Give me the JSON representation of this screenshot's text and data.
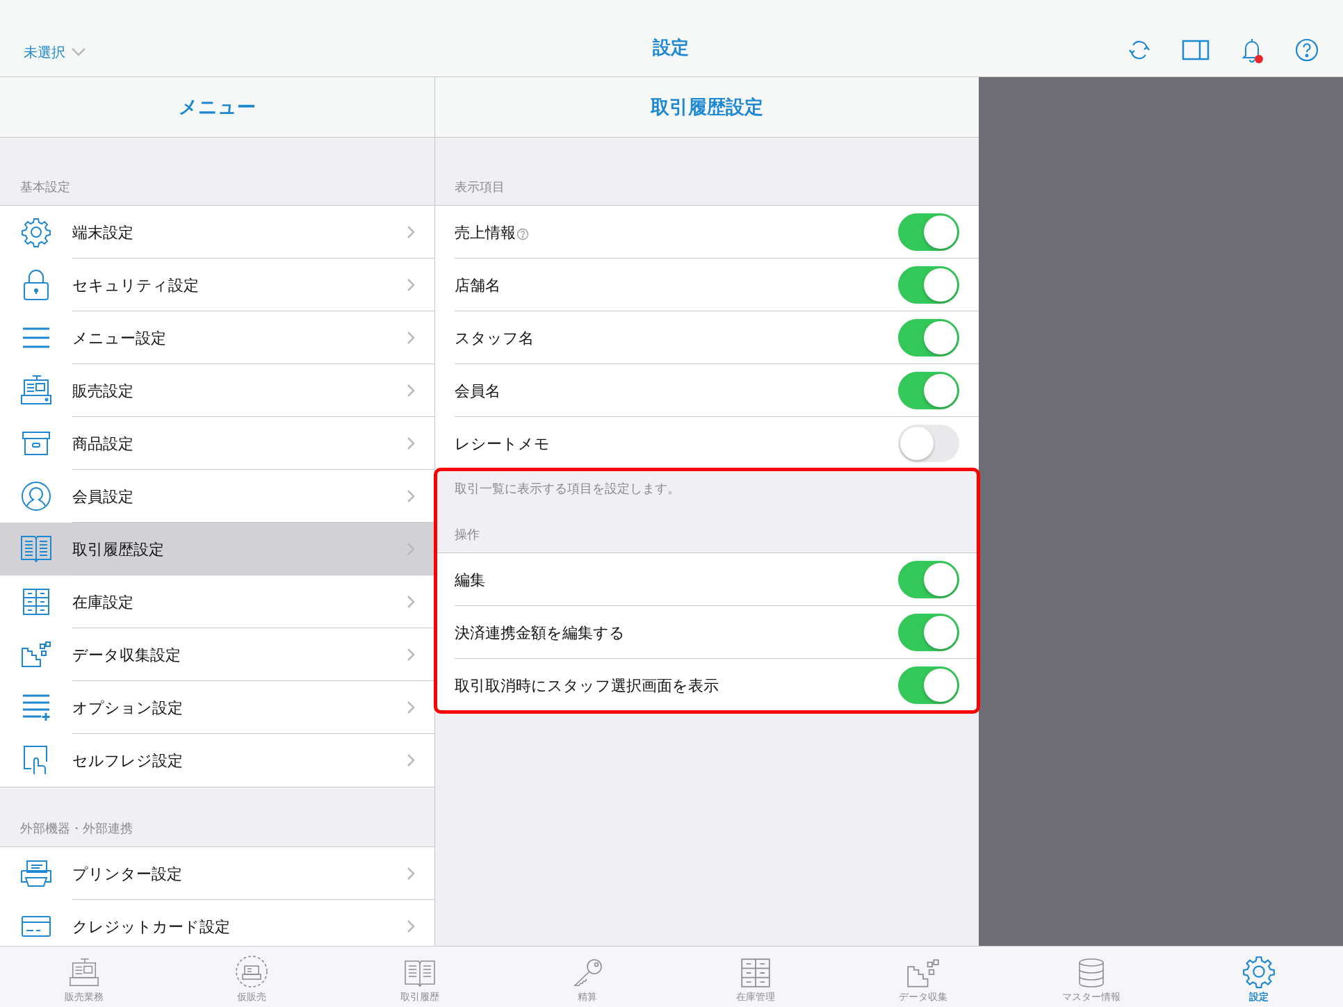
{
  "top_bar": {
    "store_selector": "未選択",
    "title": "設定"
  },
  "menu": {
    "title": "メニュー",
    "sections": [
      {
        "header": "基本設定",
        "items": [
          {
            "label": "端末設定",
            "selected": false
          },
          {
            "label": "セキュリティ設定",
            "selected": false
          },
          {
            "label": "メニュー設定",
            "selected": false
          },
          {
            "label": "販売設定",
            "selected": false
          },
          {
            "label": "商品設定",
            "selected": false
          },
          {
            "label": "会員設定",
            "selected": false
          },
          {
            "label": "取引履歴設定",
            "selected": true
          },
          {
            "label": "在庫設定",
            "selected": false
          },
          {
            "label": "データ収集設定",
            "selected": false
          },
          {
            "label": "オプション設定",
            "selected": false
          },
          {
            "label": "セルフレジ設定",
            "selected": false
          }
        ]
      },
      {
        "header": "外部機器・外部連携",
        "items": [
          {
            "label": "プリンター設定",
            "selected": false
          },
          {
            "label": "クレジットカード設定",
            "selected": false
          }
        ]
      }
    ]
  },
  "detail": {
    "title": "取引履歴設定",
    "sections": [
      {
        "header": "表示項目",
        "rows": [
          {
            "label": "売上情報",
            "help": true,
            "on": true
          },
          {
            "label": "店舗名",
            "help": false,
            "on": true
          },
          {
            "label": "スタッフ名",
            "help": false,
            "on": true
          },
          {
            "label": "会員名",
            "help": false,
            "on": true
          },
          {
            "label": "レシートメモ",
            "help": false,
            "on": false
          }
        ],
        "footer": "取引一覧に表示する項目を設定します。"
      },
      {
        "header": "操作",
        "rows": [
          {
            "label": "編集",
            "help": false,
            "on": true
          },
          {
            "label": "決済連携金額を編集する",
            "help": false,
            "on": true
          },
          {
            "label": "取引取消時にスタッフ選択画面を表示",
            "help": false,
            "on": true
          }
        ]
      }
    ]
  },
  "tab_bar": [
    {
      "label": "販売業務",
      "selected": false
    },
    {
      "label": "仮販売",
      "selected": false
    },
    {
      "label": "取引履歴",
      "selected": false
    },
    {
      "label": "精算",
      "selected": false
    },
    {
      "label": "在庫管理",
      "selected": false
    },
    {
      "label": "データ収集",
      "selected": false
    },
    {
      "label": "マスター情報",
      "selected": false
    },
    {
      "label": "設定",
      "selected": true
    }
  ]
}
